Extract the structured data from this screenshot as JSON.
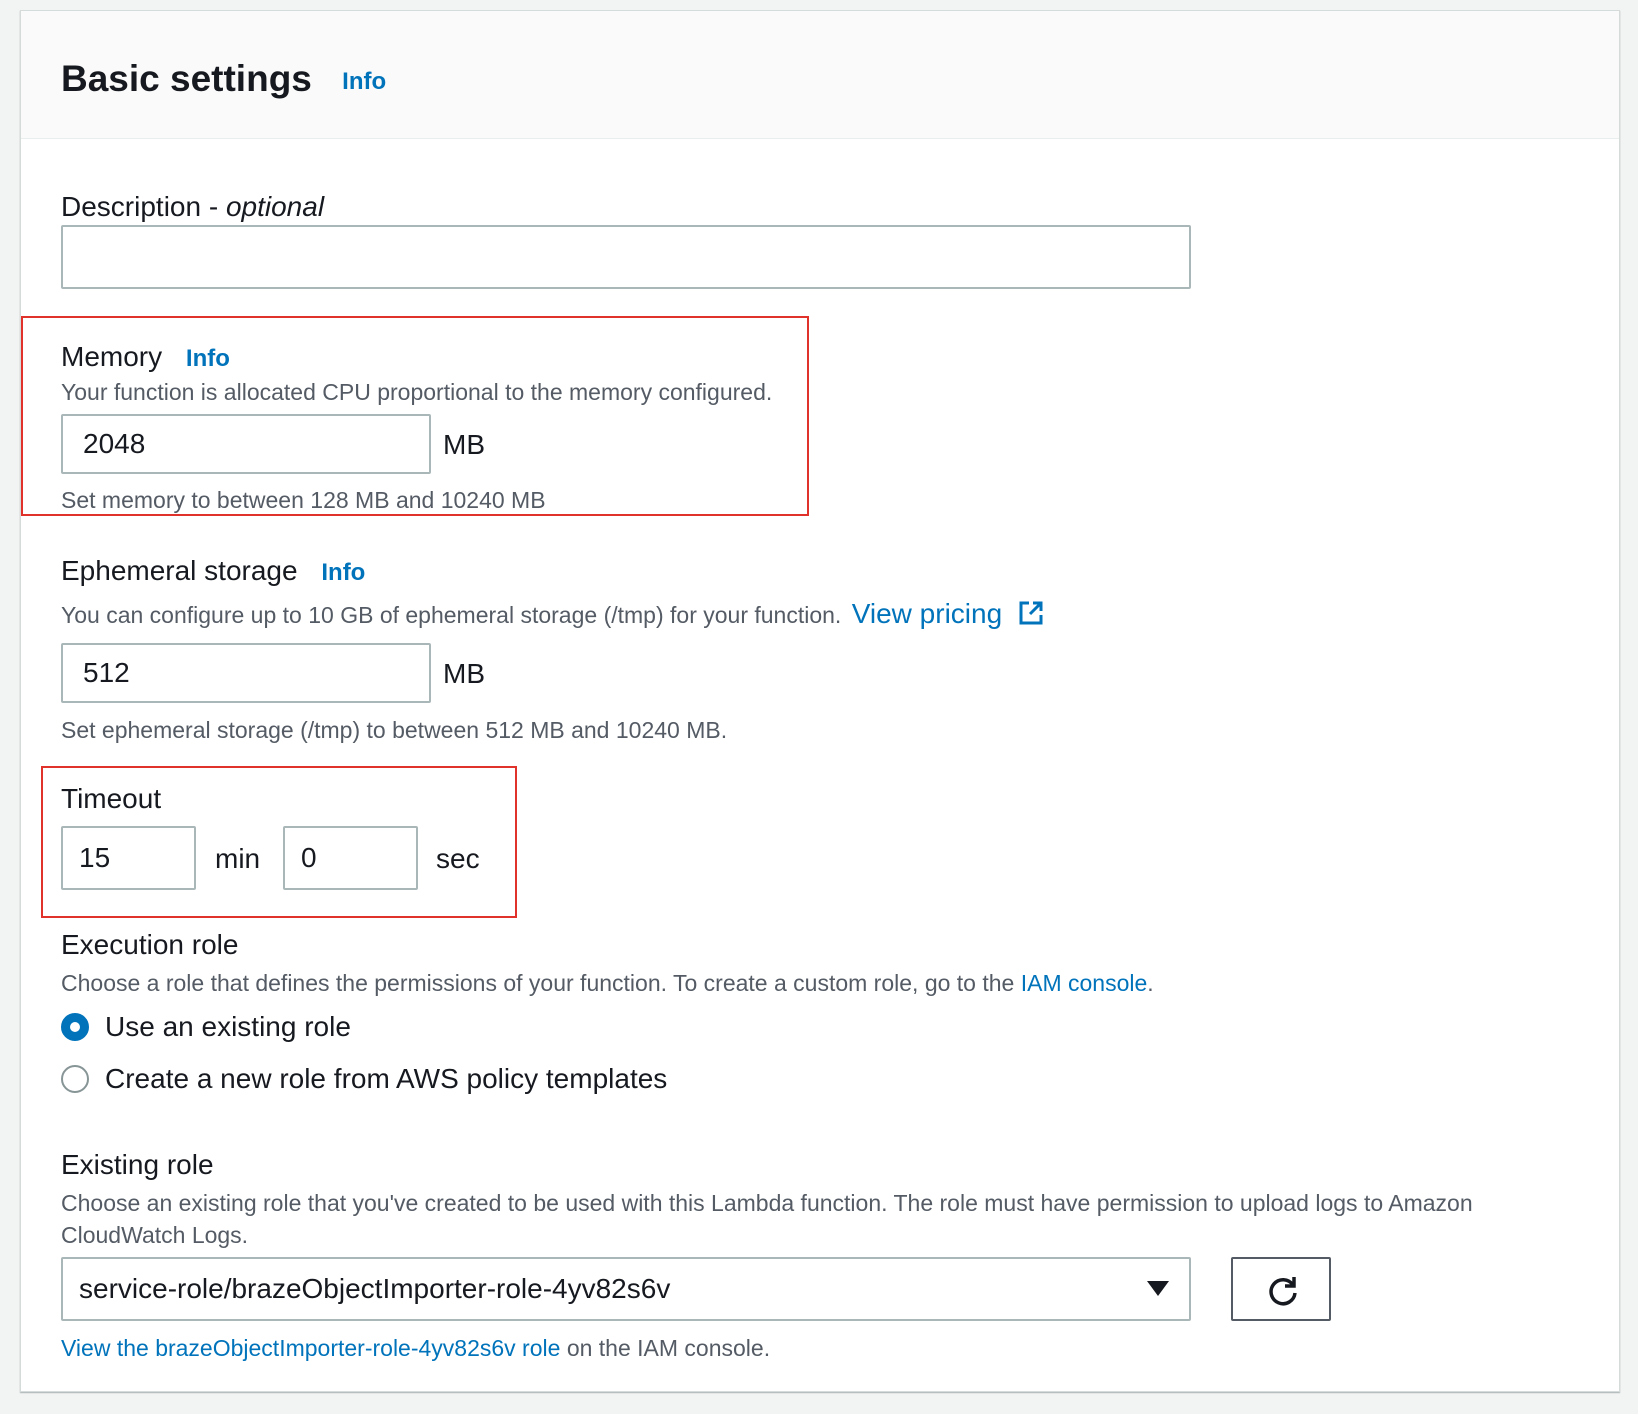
{
  "header": {
    "title": "Basic settings",
    "info": "Info"
  },
  "description": {
    "label": "Description",
    "label_suffix": "optional",
    "value": ""
  },
  "memory": {
    "label": "Memory",
    "info": "Info",
    "description": "Your function is allocated CPU proportional to the memory configured.",
    "value": "2048",
    "unit": "MB",
    "constraint": "Set memory to between 128 MB and 10240 MB"
  },
  "ephemeral_storage": {
    "label": "Ephemeral storage",
    "info": "Info",
    "description": "You can configure up to 10 GB of ephemeral storage (/tmp) for your function.",
    "pricing_link": "View pricing",
    "value": "512",
    "unit": "MB",
    "constraint": "Set ephemeral storage (/tmp) to between 512 MB and 10240 MB."
  },
  "timeout": {
    "label": "Timeout",
    "minutes": "15",
    "min_unit": "min",
    "seconds": "0",
    "sec_unit": "sec"
  },
  "execution_role": {
    "label": "Execution role",
    "description": "Choose a role that defines the permissions of your function. To create a custom role, go to the",
    "iam_link": "IAM console",
    "options": [
      {
        "label": "Use an existing role",
        "selected": true
      },
      {
        "label": "Create a new role from AWS policy templates",
        "selected": false
      }
    ]
  },
  "existing_role": {
    "label": "Existing role",
    "description_line1": "Choose an existing role that you've created to be used with this Lambda function. The role must have permission to upload logs to Amazon",
    "description_line2": "CloudWatch Logs.",
    "selected": "service-role/brazeObjectImporter-role-4yv82s6v",
    "view_link": "View the brazeObjectImporter-role-4yv82s6v role",
    "view_suffix": "on the IAM console."
  },
  "colors": {
    "link": "#0073bb",
    "highlight": "#e0312b",
    "text": "#16191f",
    "secondary_text": "#545b64"
  }
}
